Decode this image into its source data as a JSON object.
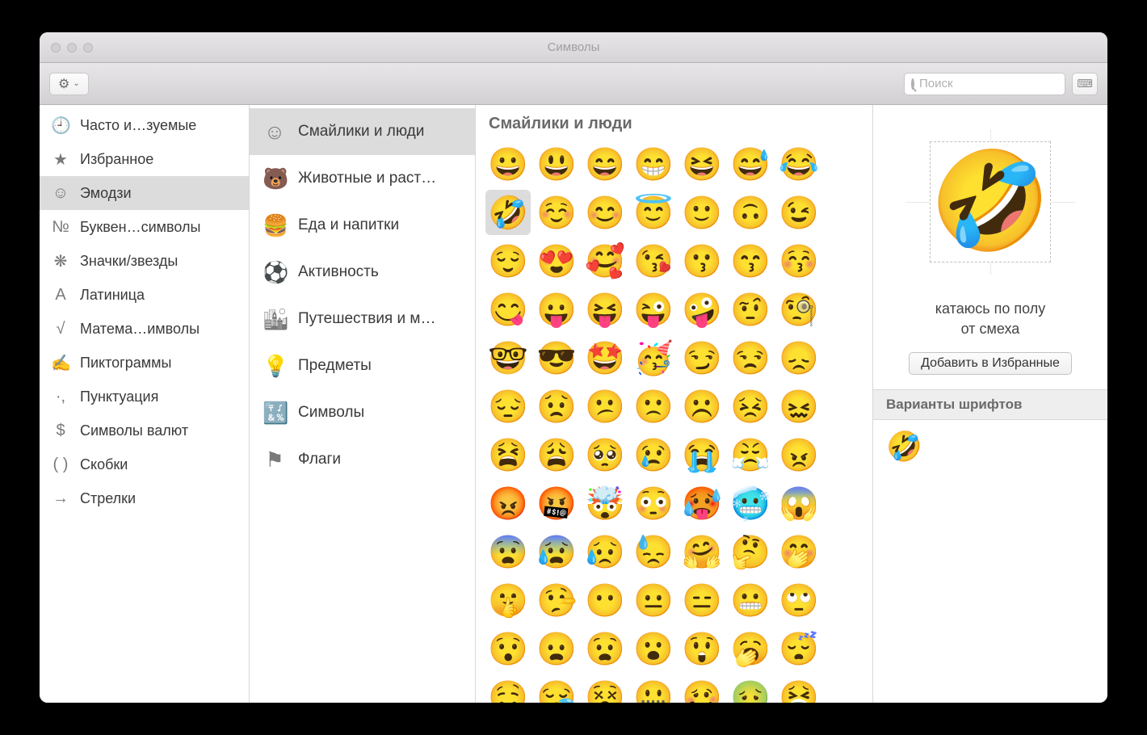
{
  "window": {
    "title": "Символы"
  },
  "toolbar": {
    "search_placeholder": "Поиск"
  },
  "sidebar_primary": {
    "items": [
      {
        "icon": "🕘",
        "label": "Часто и…зуемые"
      },
      {
        "icon": "★",
        "label": "Избранное"
      },
      {
        "icon": "☺",
        "label": "Эмодзи"
      },
      {
        "icon": "№",
        "label": "Буквен…символы"
      },
      {
        "icon": "❋",
        "label": "Значки/звезды"
      },
      {
        "icon": "A",
        "label": "Латиница"
      },
      {
        "icon": "√",
        "label": "Матема…имволы"
      },
      {
        "icon": "✍",
        "label": "Пиктограммы"
      },
      {
        "icon": "·,",
        "label": "Пунктуация"
      },
      {
        "icon": "$",
        "label": "Символы валют"
      },
      {
        "icon": "( )",
        "label": "Скобки"
      },
      {
        "icon": "→",
        "label": "Стрелки"
      }
    ],
    "selected_index": 2
  },
  "sidebar_secondary": {
    "items": [
      {
        "icon": "☺",
        "label": "Смайлики и люди"
      },
      {
        "icon": "🐻",
        "label": "Животные и раст…"
      },
      {
        "icon": "🍔",
        "label": "Еда и напитки"
      },
      {
        "icon": "⚽",
        "label": "Активность"
      },
      {
        "icon": "🏙",
        "label": "Путешествия и м…"
      },
      {
        "icon": "💡",
        "label": "Предметы"
      },
      {
        "icon": "🔣",
        "label": "Символы"
      },
      {
        "icon": "⚑",
        "label": "Флаги"
      }
    ],
    "selected_index": 0
  },
  "grid": {
    "title": "Смайлики и люди",
    "selected_index": 7,
    "emojis": [
      "😀",
      "😃",
      "😄",
      "😁",
      "😆",
      "😅",
      "😂",
      "🤣",
      "☺️",
      "😊",
      "😇",
      "🙂",
      "🙃",
      "😉",
      "😌",
      "😍",
      "🥰",
      "😘",
      "😗",
      "😙",
      "😚",
      "😋",
      "😛",
      "😝",
      "😜",
      "🤪",
      "🤨",
      "🧐",
      "🤓",
      "😎",
      "🤩",
      "🥳",
      "😏",
      "😒",
      "😞",
      "😔",
      "😟",
      "😕",
      "🙁",
      "☹️",
      "😣",
      "😖",
      "😫",
      "😩",
      "🥺",
      "😢",
      "😭",
      "😤",
      "😠",
      "😡",
      "🤬",
      "🤯",
      "😳",
      "🥵",
      "🥶",
      "😱",
      "😨",
      "😰",
      "😥",
      "😓",
      "🤗",
      "🤔",
      "🤭",
      "🤫",
      "🤥",
      "😶",
      "😐",
      "😑",
      "😬",
      "🙄",
      "😯",
      "😦",
      "😧",
      "😮",
      "😲",
      "🥱",
      "😴",
      "🤤",
      "😪",
      "😵",
      "🤐",
      "🥴",
      "🤢",
      "🤮"
    ]
  },
  "preview": {
    "emoji": "🤣",
    "name_line1": "катаюсь по полу",
    "name_line2": "от смеха",
    "add_favorite_label": "Добавить в Избранные",
    "variants_header": "Варианты шрифтов",
    "variant_emoji": "🤣"
  }
}
